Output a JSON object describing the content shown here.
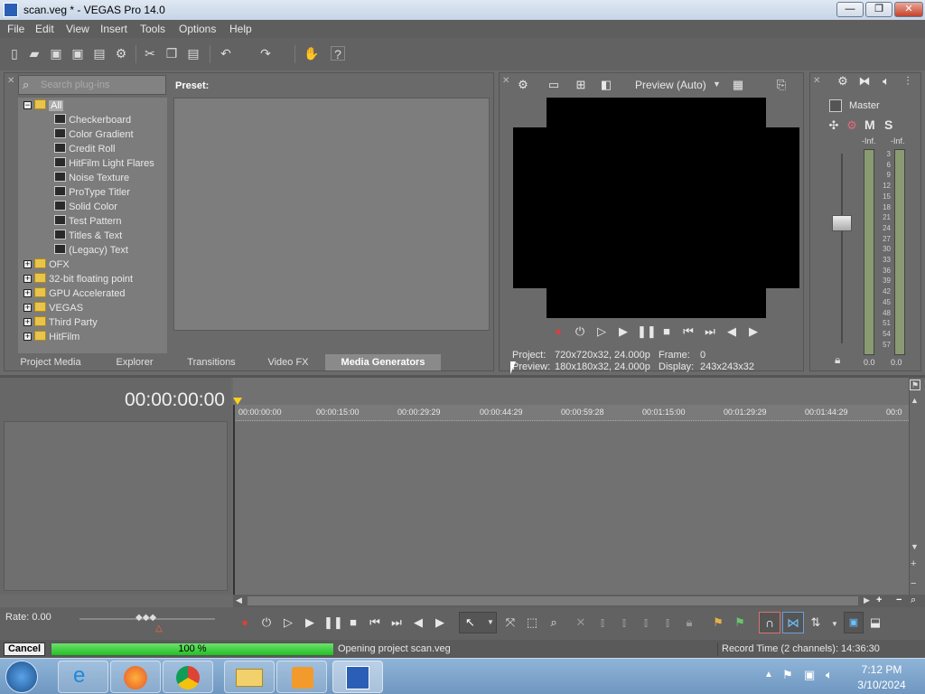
{
  "window": {
    "title": "scan.veg * - VEGAS Pro 14.0",
    "minimize": "—",
    "maximize": "❐",
    "close": "✕"
  },
  "menu": [
    "File",
    "Edit",
    "View",
    "Insert",
    "Tools",
    "Options",
    "Help"
  ],
  "plugins": {
    "search_placeholder": "Search plug-ins",
    "preset_label": "Preset:",
    "root": "All",
    "generators": [
      "Checkerboard",
      "Color Gradient",
      "Credit Roll",
      "HitFilm Light Flares",
      "Noise Texture",
      "ProType Titler",
      "Solid Color",
      "Test Pattern",
      "Titles & Text",
      "(Legacy) Text"
    ],
    "folders": [
      "OFX",
      "32-bit floating point",
      "GPU Accelerated",
      "VEGAS",
      "Third Party",
      "HitFilm"
    ]
  },
  "tabs": [
    "Project Media",
    "Explorer",
    "Transitions",
    "Video FX",
    "Media Generators"
  ],
  "preview": {
    "mode": "Preview (Auto)",
    "project_label": "Project:",
    "project_value": "720x720x32, 24.000p",
    "frame_label": "Frame:",
    "frame_value": "0",
    "preview_label": "Preview:",
    "preview_value": "180x180x32, 24.000p",
    "display_label": "Display:",
    "display_value": "243x243x32"
  },
  "master": {
    "label": "Master",
    "mute": "M",
    "solo": "S",
    "inf_left": "-Inf.",
    "inf_right": "-Inf.",
    "scale": [
      "3",
      "6",
      "9",
      "12",
      "15",
      "18",
      "21",
      "24",
      "27",
      "30",
      "33",
      "36",
      "39",
      "42",
      "45",
      "48",
      "51",
      "54",
      "57"
    ],
    "bottom_left": "0.0",
    "bottom_right": "0.0"
  },
  "timeline": {
    "timecode": "00:00:00:00",
    "ruler": [
      "00:00:00:00",
      "00:00:15:00",
      "00:00:29:29",
      "00:00:44:29",
      "00:00:59:28",
      "00:01:15:00",
      "00:01:29:29",
      "00:01:44:29",
      "00:0"
    ],
    "rate": "Rate: 0.00"
  },
  "status": {
    "cancel": "Cancel",
    "progress_percent": 100,
    "progress_text": "100 %",
    "message": "Opening project scan.veg",
    "record_time": "Record Time (2 channels): 14:36:30"
  },
  "taskbar": {
    "time": "7:12 PM",
    "date": "3/10/2024"
  }
}
